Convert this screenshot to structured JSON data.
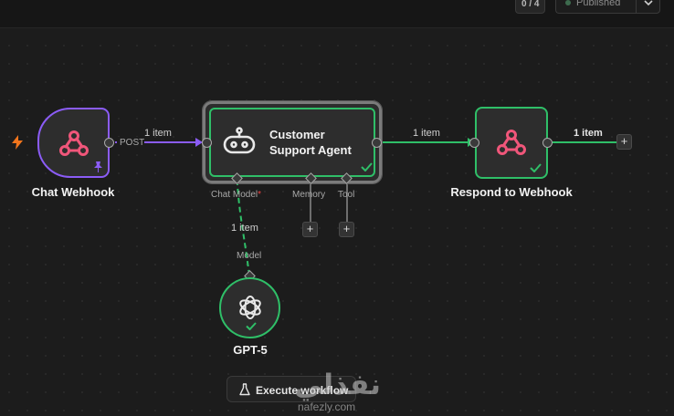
{
  "toolbar": {
    "counter": "0 / 4",
    "published_label": "Published"
  },
  "nodes": {
    "trigger": {
      "name": "Chat Webhook",
      "output_label": "POST"
    },
    "agent": {
      "name_line1": "Customer",
      "name_line2": "Support Agent",
      "port_chat_model": "Chat Model",
      "required_marker": "*",
      "port_memory": "Memory",
      "port_tool": "Tool"
    },
    "respond": {
      "name": "Respond to Webhook"
    },
    "model": {
      "name": "GPT-5",
      "input_label": "Model"
    }
  },
  "edges": {
    "trigger_to_agent": "1 item",
    "agent_to_respond": "1 item",
    "respond_out": "1 item",
    "model_to_agent": "1 item"
  },
  "execute_button": {
    "label": "Execute workflow"
  },
  "watermark": {
    "brand": "نفذلي",
    "url": "nafezly.com"
  },
  "colors": {
    "trigger_border": "#8b5cf6",
    "success": "#2fbf68",
    "trigger_bolt": "#f2751c",
    "webhook_icon": "#f0567a"
  }
}
